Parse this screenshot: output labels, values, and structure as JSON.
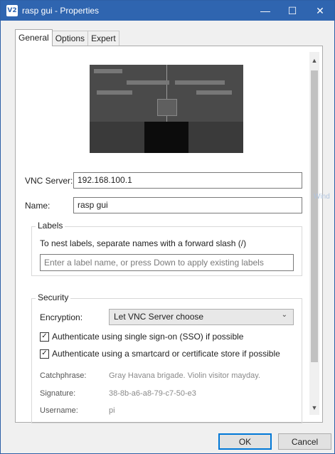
{
  "window": {
    "title": "rasp gui - Properties",
    "icon_text": "V2",
    "minimize_glyph": "—",
    "maximize_glyph": "☐",
    "close_glyph": "✕"
  },
  "tabs": [
    {
      "label": "General",
      "active": true
    },
    {
      "label": "Options",
      "active": false
    },
    {
      "label": "Expert",
      "active": false
    }
  ],
  "general": {
    "vnc_server_label": "VNC Server:",
    "vnc_server_value": "192.168.100.1",
    "name_label": "Name:",
    "name_value": "rasp gui",
    "labels_group_title": "Labels",
    "labels_hint": "To nest labels, separate names with a forward slash (/)",
    "labels_placeholder": "Enter a label name, or press Down to apply existing labels",
    "security_group_title": "Security",
    "encryption_label": "Encryption:",
    "encryption_value": "Let VNC Server choose",
    "sso_checkbox_label": "Authenticate using single sign-on (SSO) if possible",
    "sso_checked": true,
    "smartcard_checkbox_label": "Authenticate using a smartcard or certificate store if possible",
    "smartcard_checked": true,
    "catchphrase_label": "Catchphrase:",
    "catchphrase_value": "Gray Havana brigade. Violin visitor mayday.",
    "signature_label": "Signature:",
    "signature_value": "38-8b-a6-a8-79-c7-50-e3",
    "username_label": "Username:",
    "username_value": "pi"
  },
  "buttons": {
    "ok_label": "OK",
    "cancel_label": "Cancel"
  },
  "side_watermark": "Wind",
  "colors": {
    "titlebar": "#2f65b0",
    "default_button_border": "#0078d7"
  }
}
